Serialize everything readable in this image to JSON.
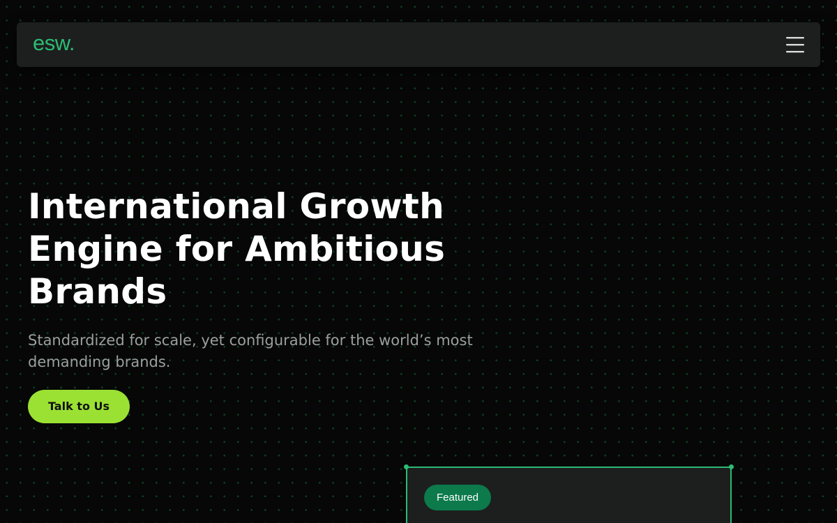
{
  "header": {
    "logo_text": "esw.",
    "menu_icon": "hamburger-menu-icon"
  },
  "hero": {
    "title": "International Growth Engine for Ambitious Brands",
    "subtitle": "Standardized for scale, yet configurable for the world’s most demanding brands.",
    "cta_label": "Talk to Us"
  },
  "featured_card": {
    "badge": "Featured"
  },
  "colors": {
    "background": "#060706",
    "dot_pattern": "#1c8a4e",
    "navbar": "#1c1f1e",
    "brand_green": "#2dbb75",
    "cta_lime": "#9be133",
    "badge_green": "#0c7a4b",
    "subtitle_gray": "#9aa09e",
    "title_white": "#ffffff"
  }
}
